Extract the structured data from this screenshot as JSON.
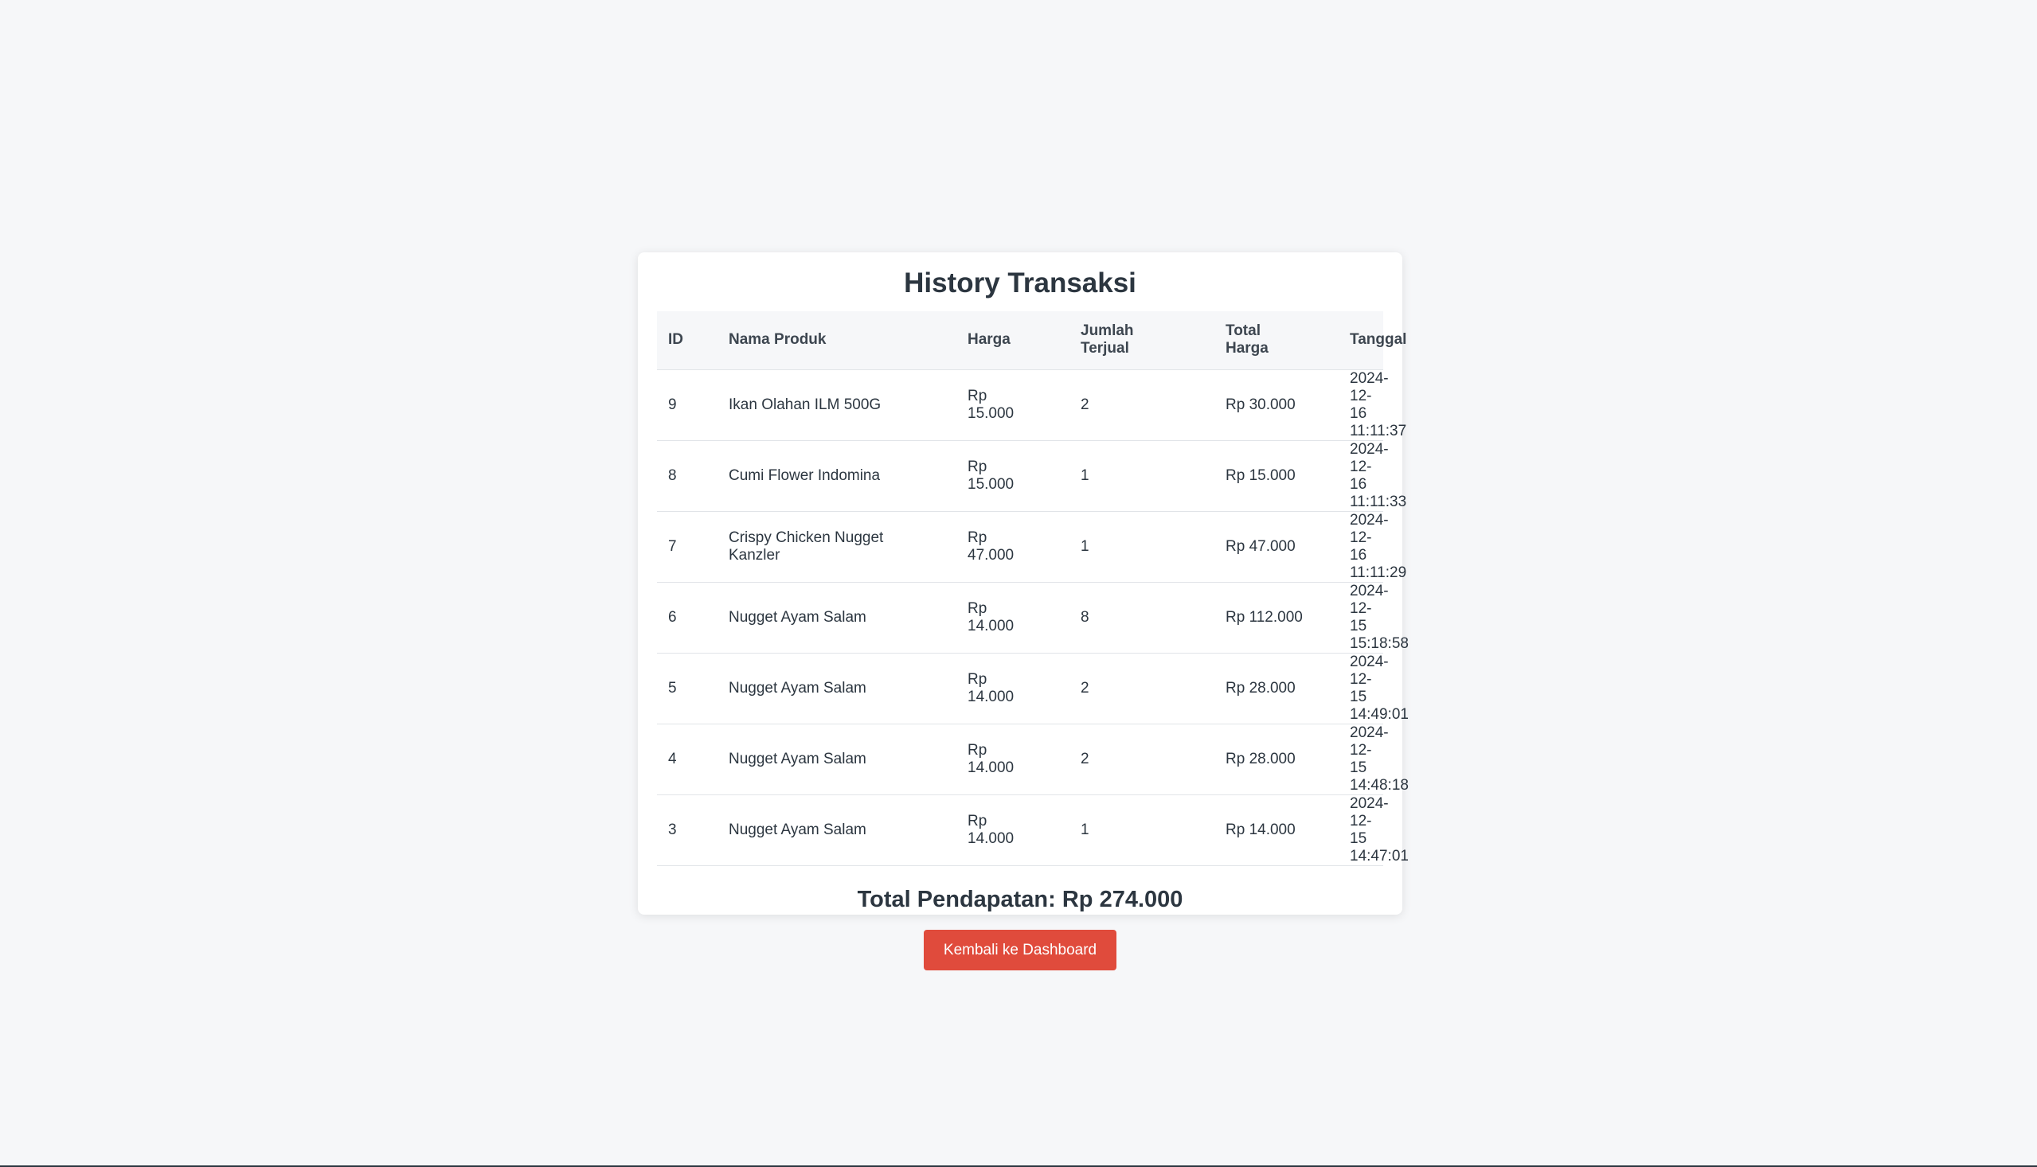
{
  "page": {
    "title": "History Transaksi",
    "columns": [
      "ID",
      "Nama Produk",
      "Harga",
      "Jumlah\nTerjual",
      "Total\nHarga",
      "Tanggal"
    ],
    "rows": [
      {
        "id": "9",
        "produk": "Ikan Olahan ILM 500G",
        "harga": "Rp\n15.000",
        "jumlah": "2",
        "total": "Rp 30.000",
        "tanggal": "2024-12-16\n11:11:37"
      },
      {
        "id": "8",
        "produk": "Cumi Flower Indomina",
        "harga": "Rp\n15.000",
        "jumlah": "1",
        "total": "Rp 15.000",
        "tanggal": "2024-12-16\n11:11:33"
      },
      {
        "id": "7",
        "produk": "Crispy Chicken Nugget\nKanzler",
        "harga": "Rp\n47.000",
        "jumlah": "1",
        "total": "Rp 47.000",
        "tanggal": "2024-12-16\n11:11:29"
      },
      {
        "id": "6",
        "produk": "Nugget Ayam Salam",
        "harga": "Rp\n14.000",
        "jumlah": "8",
        "total": "Rp 112.000",
        "tanggal": "2024-12-15\n15:18:58"
      },
      {
        "id": "5",
        "produk": "Nugget Ayam Salam",
        "harga": "Rp\n14.000",
        "jumlah": "2",
        "total": "Rp 28.000",
        "tanggal": "2024-12-15\n14:49:01"
      },
      {
        "id": "4",
        "produk": "Nugget Ayam Salam",
        "harga": "Rp\n14.000",
        "jumlah": "2",
        "total": "Rp 28.000",
        "tanggal": "2024-12-15\n14:48:18"
      },
      {
        "id": "3",
        "produk": "Nugget Ayam Salam",
        "harga": "Rp\n14.000",
        "jumlah": "1",
        "total": "Rp 14.000",
        "tanggal": "2024-12-15\n14:47:01"
      }
    ],
    "total_pendapatan": "Total Pendapatan: Rp 274.000",
    "back_button_label": "Kembali ke Dashboard"
  },
  "colors": {
    "page_background": "#f6f7f9",
    "card_background": "#ffffff",
    "button_background": "#e04b3c",
    "text": "#2c3640"
  }
}
